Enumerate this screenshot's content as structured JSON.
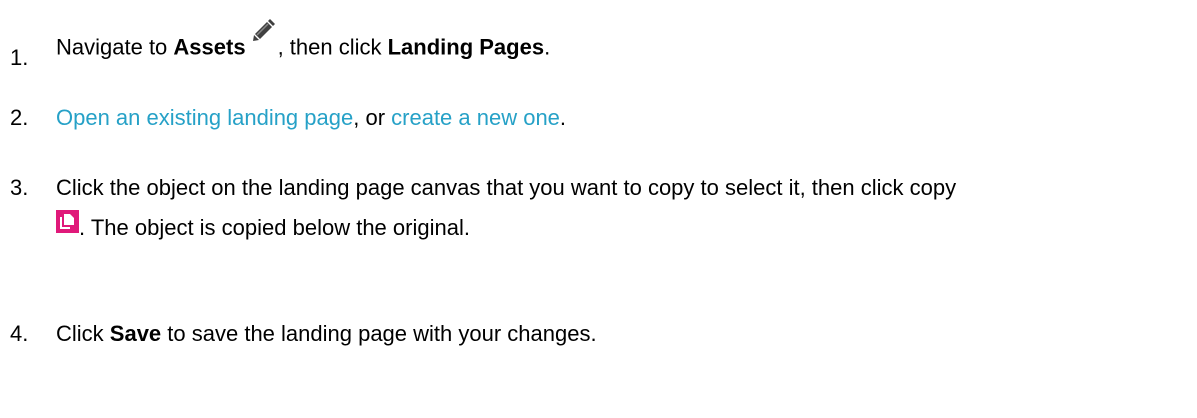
{
  "steps": [
    {
      "number": "1.",
      "parts": {
        "a": "Navigate to ",
        "b": "Assets",
        "c": ", then click ",
        "d": "Landing Pages",
        "e": "."
      },
      "icon": "pencil-icon"
    },
    {
      "number": "2.",
      "parts": {
        "link1": "Open an existing landing page",
        "mid": ", or ",
        "link2": "create a new one",
        "end": "."
      }
    },
    {
      "number": "3.",
      "line1": "Click the object on the landing page canvas that you want to copy to select it, then click copy",
      "line2": ". The object is copied below the original.",
      "icon": "copy-icon"
    },
    {
      "number": "4.",
      "parts": {
        "a": "Click ",
        "b": "Save",
        "c": " to save the landing page with your changes."
      }
    }
  ],
  "colors": {
    "link": "#26A1C7",
    "copy_icon": "#E0197A",
    "pencil_icon": "#404040"
  }
}
